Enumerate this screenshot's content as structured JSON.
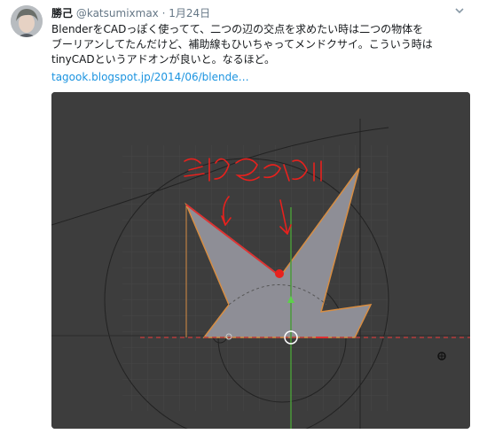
{
  "tweet": {
    "author_name": "勝己",
    "author_handle": "@katsumixmax",
    "separator": "·",
    "date": "1月24日",
    "text_lines": [
      "BlenderをCADっぽく使ってて、二つの辺の交点を求めたい時は二つの物体を",
      "ブーリアンしてたんだけど、補助線もひいちゃってメンドクサイ。こういう時は",
      "tinyCADというアドオンが良いと。なるほど。"
    ],
    "link": "tagook.blogspot.jp/2014/06/blende…"
  },
  "icons": {
    "more": "chevron-down-icon",
    "avatar": "user-avatar"
  },
  "colors": {
    "link": "#1c94e0",
    "viewport_bg": "#3d3d3d",
    "annotation": "#e8211d",
    "mesh_fill": "#8e8e96"
  },
  "media": {
    "handwritten_annotation": "交点求めたい"
  }
}
